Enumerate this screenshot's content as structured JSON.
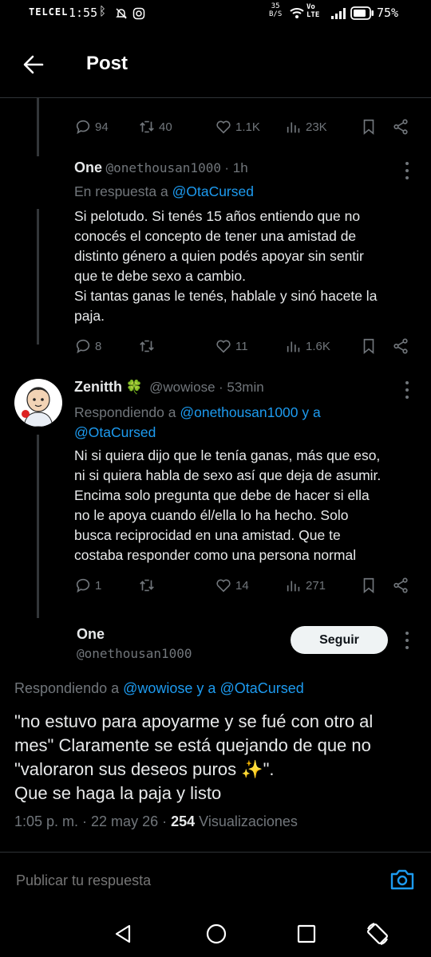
{
  "status_bar": {
    "carrier": "TELCEL",
    "time": "1:55",
    "speed_top": "35",
    "speed_unit": "B/S",
    "volte_top": "Vo",
    "volte_bottom": "LTE",
    "battery": "75%"
  },
  "header": {
    "title": "Post"
  },
  "prev_post_actions": {
    "replies": "94",
    "reposts": "40",
    "likes": "1.1K",
    "views": "23K"
  },
  "reply1": {
    "name": "One",
    "handle": "@onethousan1000",
    "time": "· 1h",
    "reply_prefix": "En respuesta a",
    "reply_to": "@OtaCursed",
    "text": "Si pelotudo. Si tenés 15 años entiendo que no\nconocés el concepto de tener una amistad de\ndistinto género a quien podés apoyar sin sentir\nque te debe sexo a cambio.\nSi tantas ganas le tenés, hablale y sinó hacete la\npaja.",
    "actions": {
      "replies": "8",
      "reposts": "",
      "likes": "11",
      "views": "1.6K"
    }
  },
  "reply2": {
    "name": "Zenitth",
    "emoji": "🍀",
    "handle": "@wowiose",
    "time": "· 53min",
    "reply_prefix": "Respondiendo a",
    "reply_to_line1": "@onethousan1000 y a",
    "reply_to_line2": "@OtaCursed",
    "text": "Ni si quiera dijo que le tenía ganas, más que eso,\nni si quiera habla de sexo así que deja de asumir.\nEncima solo pregunta que debe de hacer si ella\nno le apoya cuando él/ella lo ha hecho. Solo\nbusca reciprocidad en una amistad. Que te\ncostaba responder como una persona normal",
    "actions": {
      "replies": "1",
      "reposts": "",
      "likes": "14",
      "views": "271"
    }
  },
  "main_post": {
    "name": "One",
    "handle": "@onethousan1000",
    "follow_label": "Seguir",
    "reply_prefix": "Respondiendo a",
    "reply_to": "@wowiose y a @OtaCursed",
    "text": "\"no estuvo para apoyarme y se fué con otro al\nmes\" Claramente se está quejando de que no\n\"valoraron sus deseos puros ✨\".\nQue se haga la paja y listo",
    "timestamp": "1:05 p. m. · 22 may 26 ·",
    "views_count": "254",
    "views_label": "Visualizaciones"
  },
  "reply_bar": {
    "placeholder": "Publicar tu respuesta"
  },
  "colors": {
    "background": "#000000",
    "accent": "#1d9bf0",
    "muted": "#71767b",
    "text": "#e7e9ea"
  }
}
